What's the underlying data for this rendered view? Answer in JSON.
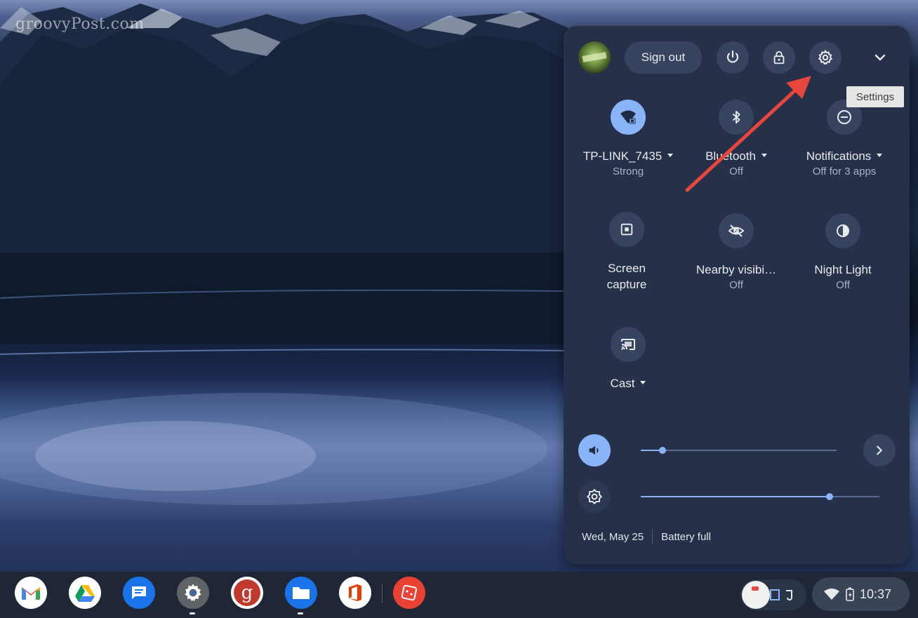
{
  "watermark": "groovyPost.com",
  "header": {
    "sign_out_label": "Sign out",
    "power_icon": "power-icon",
    "lock_icon": "lock-icon",
    "settings_icon": "gear-icon",
    "collapse_icon": "chevron-down-icon"
  },
  "tooltip": "Settings",
  "tiles": [
    {
      "label": "TP-LINK_7435",
      "sub": "Strong",
      "icon": "wifi-lock-icon",
      "active": true,
      "has_dropdown": true
    },
    {
      "label": "Bluetooth",
      "sub": "Off",
      "icon": "bluetooth-icon",
      "active": false,
      "has_dropdown": true
    },
    {
      "label": "Notifications",
      "sub": "Off for 3 apps",
      "icon": "do-not-disturb-icon",
      "active": false,
      "has_dropdown": true
    },
    {
      "label": "Screen capture",
      "sub": "",
      "icon": "screen-capture-icon",
      "active": false,
      "has_dropdown": false
    },
    {
      "label": "Nearby visibi…",
      "sub": "Off",
      "icon": "eye-off-icon",
      "active": false,
      "has_dropdown": false
    },
    {
      "label": "Night Light",
      "sub": "Off",
      "icon": "night-light-icon",
      "active": false,
      "has_dropdown": false
    },
    {
      "label": "Cast",
      "sub": "",
      "icon": "cast-icon",
      "active": false,
      "has_dropdown": true
    }
  ],
  "sliders": {
    "volume": {
      "icon": "volume-icon",
      "level": 0.11
    },
    "brightness": {
      "icon": "brightness-icon",
      "level": 0.79
    }
  },
  "footer": {
    "date": "Wed, May 25",
    "battery": "Battery full"
  },
  "shelf": {
    "apps": [
      "Gmail",
      "Google Drive",
      "Messages",
      "Settings",
      "groovyPost",
      "Files",
      "Office",
      "Other app"
    ],
    "clock": "10:37"
  },
  "colors": {
    "panel_bg": "#263149",
    "accent": "#8ab4f8",
    "button_bg": "#37435f",
    "arrow": "#e8453c"
  }
}
